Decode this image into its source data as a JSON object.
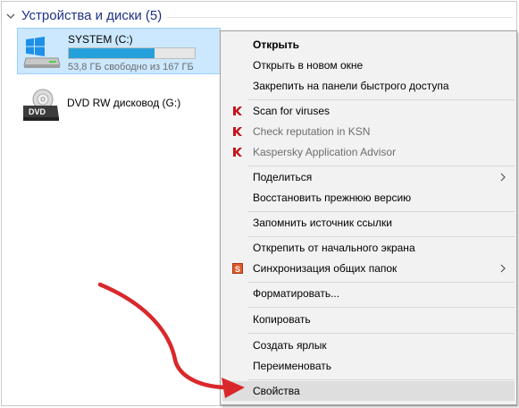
{
  "group": {
    "title": "Устройства и диски (5)"
  },
  "drives": [
    {
      "name": "SYSTEM (C:)",
      "free_text": "53,8 ГБ свободно из 167 ГБ",
      "usage_fraction": 0.68,
      "icon": "windows-drive-icon"
    },
    {
      "name": "DVD RW дисковод (G:)",
      "icon_label": "DVD",
      "icon": "dvd-drive-icon"
    }
  ],
  "menu": {
    "items": [
      {
        "label": "Открыть"
      },
      {
        "label": "Открыть в новом окне"
      },
      {
        "label": "Закрепить на панели быстрого доступа"
      },
      {
        "label": "Scan for viruses",
        "icon": "kaspersky-icon"
      },
      {
        "label": "Check reputation in KSN",
        "icon": "kaspersky-icon"
      },
      {
        "label": "Kaspersky Application Advisor",
        "icon": "kaspersky-icon"
      },
      {
        "label": "Поделиться",
        "submenu": true
      },
      {
        "label": "Восстановить прежнюю версию"
      },
      {
        "label": "Запомнить источник ссылки"
      },
      {
        "label": "Открепить от начального экрана"
      },
      {
        "label": "Синхронизация общих папок",
        "icon": "sync-icon",
        "submenu": true
      },
      {
        "label": "Форматировать..."
      },
      {
        "label": "Копировать"
      },
      {
        "label": "Создать ярлык"
      },
      {
        "label": "Переименовать"
      },
      {
        "label": "Свойства"
      }
    ]
  },
  "colors": {
    "selection": "#cce8ff",
    "progress": "#26a0da",
    "group_title": "#1e3287",
    "annotation_arrow": "#d9282b",
    "kaspersky": "#c4161c"
  }
}
